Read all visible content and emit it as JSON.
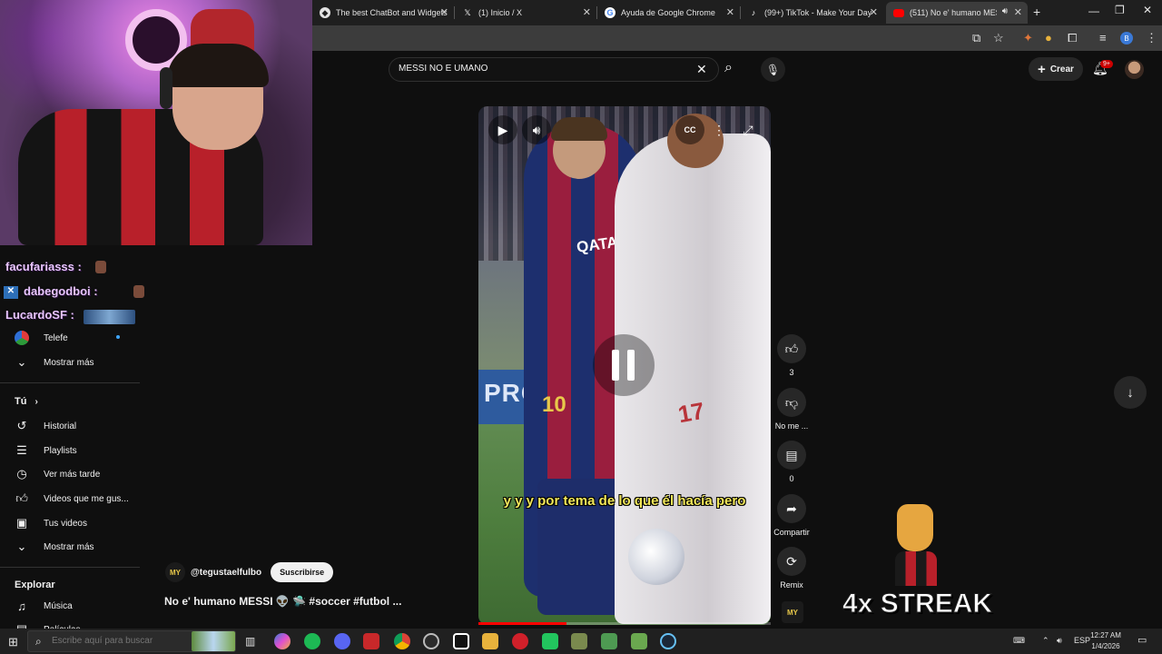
{
  "browser": {
    "tabs": [
      {
        "title": "The best ChatBot and Widgets"
      },
      {
        "title": "(1) Inicio / X"
      },
      {
        "title": "Ayuda de Google Chrome"
      },
      {
        "title": "(99+) TikTok - Make Your Day"
      },
      {
        "title": "(511) No e' humano MESSI"
      }
    ],
    "new_tab_glyph": "+",
    "profile_letter": "B",
    "colors": {
      "tabbar": "#1f1f1f",
      "toolbar": "#3c3c3c"
    }
  },
  "stream_overlay": {
    "chat": [
      {
        "user": "facufariasss :"
      },
      {
        "user": "dabegodboi :"
      },
      {
        "user": "LucardoSF :"
      }
    ],
    "streak_text": "4x STREAK"
  },
  "youtube": {
    "search_value": "MESSI NO E UMANO",
    "create_label": "Crear",
    "notifications_badge": "9+",
    "sidebar": {
      "subscriptions_partial": [
        {
          "label": "Telefe",
          "icon": "channel-avatar-icon"
        },
        {
          "label": "Mostrar más",
          "icon": "chevron-down-icon"
        }
      ],
      "you_heading": "Tú",
      "you_items": [
        {
          "label": "Historial",
          "icon": "history-icon"
        },
        {
          "label": "Playlists",
          "icon": "playlist-icon"
        },
        {
          "label": "Ver más tarde",
          "icon": "clock-icon"
        },
        {
          "label": "Videos que me gus...",
          "icon": "thumbs-up-icon"
        },
        {
          "label": "Tus videos",
          "icon": "video-icon"
        },
        {
          "label": "Mostrar más",
          "icon": "chevron-down-icon"
        }
      ],
      "explore_heading": "Explorar",
      "explore_items": [
        {
          "label": "Música",
          "icon": "music-icon"
        },
        {
          "label": "Películas",
          "icon": "film-icon"
        }
      ]
    },
    "video": {
      "caption": "y y y por tema de lo que él hacía pero",
      "board_text": "PROM",
      "jersey_text": "QATAR",
      "progress": 0.3
    },
    "actions": [
      {
        "name": "like",
        "label": "3",
        "icon": "thumbs-up-icon"
      },
      {
        "name": "dislike",
        "label": "No me ...",
        "icon": "thumbs-down-icon"
      },
      {
        "name": "comments",
        "label": "0",
        "icon": "comment-icon"
      },
      {
        "name": "share",
        "label": "Compartir",
        "icon": "share-icon"
      },
      {
        "name": "remix",
        "label": "Remix",
        "icon": "remix-icon"
      }
    ],
    "channel": {
      "handle": "@tegustaelfulbo",
      "subscribe_label": "Suscribirse",
      "avatar_text": "MY"
    },
    "title": "No e' humano MESSI 👽 🛸 #soccer #futbol ..."
  },
  "taskbar": {
    "search_placeholder": "Escribe aquí para buscar",
    "language": "ESP",
    "time": "12:27 AM",
    "date": "1/4/2026"
  }
}
